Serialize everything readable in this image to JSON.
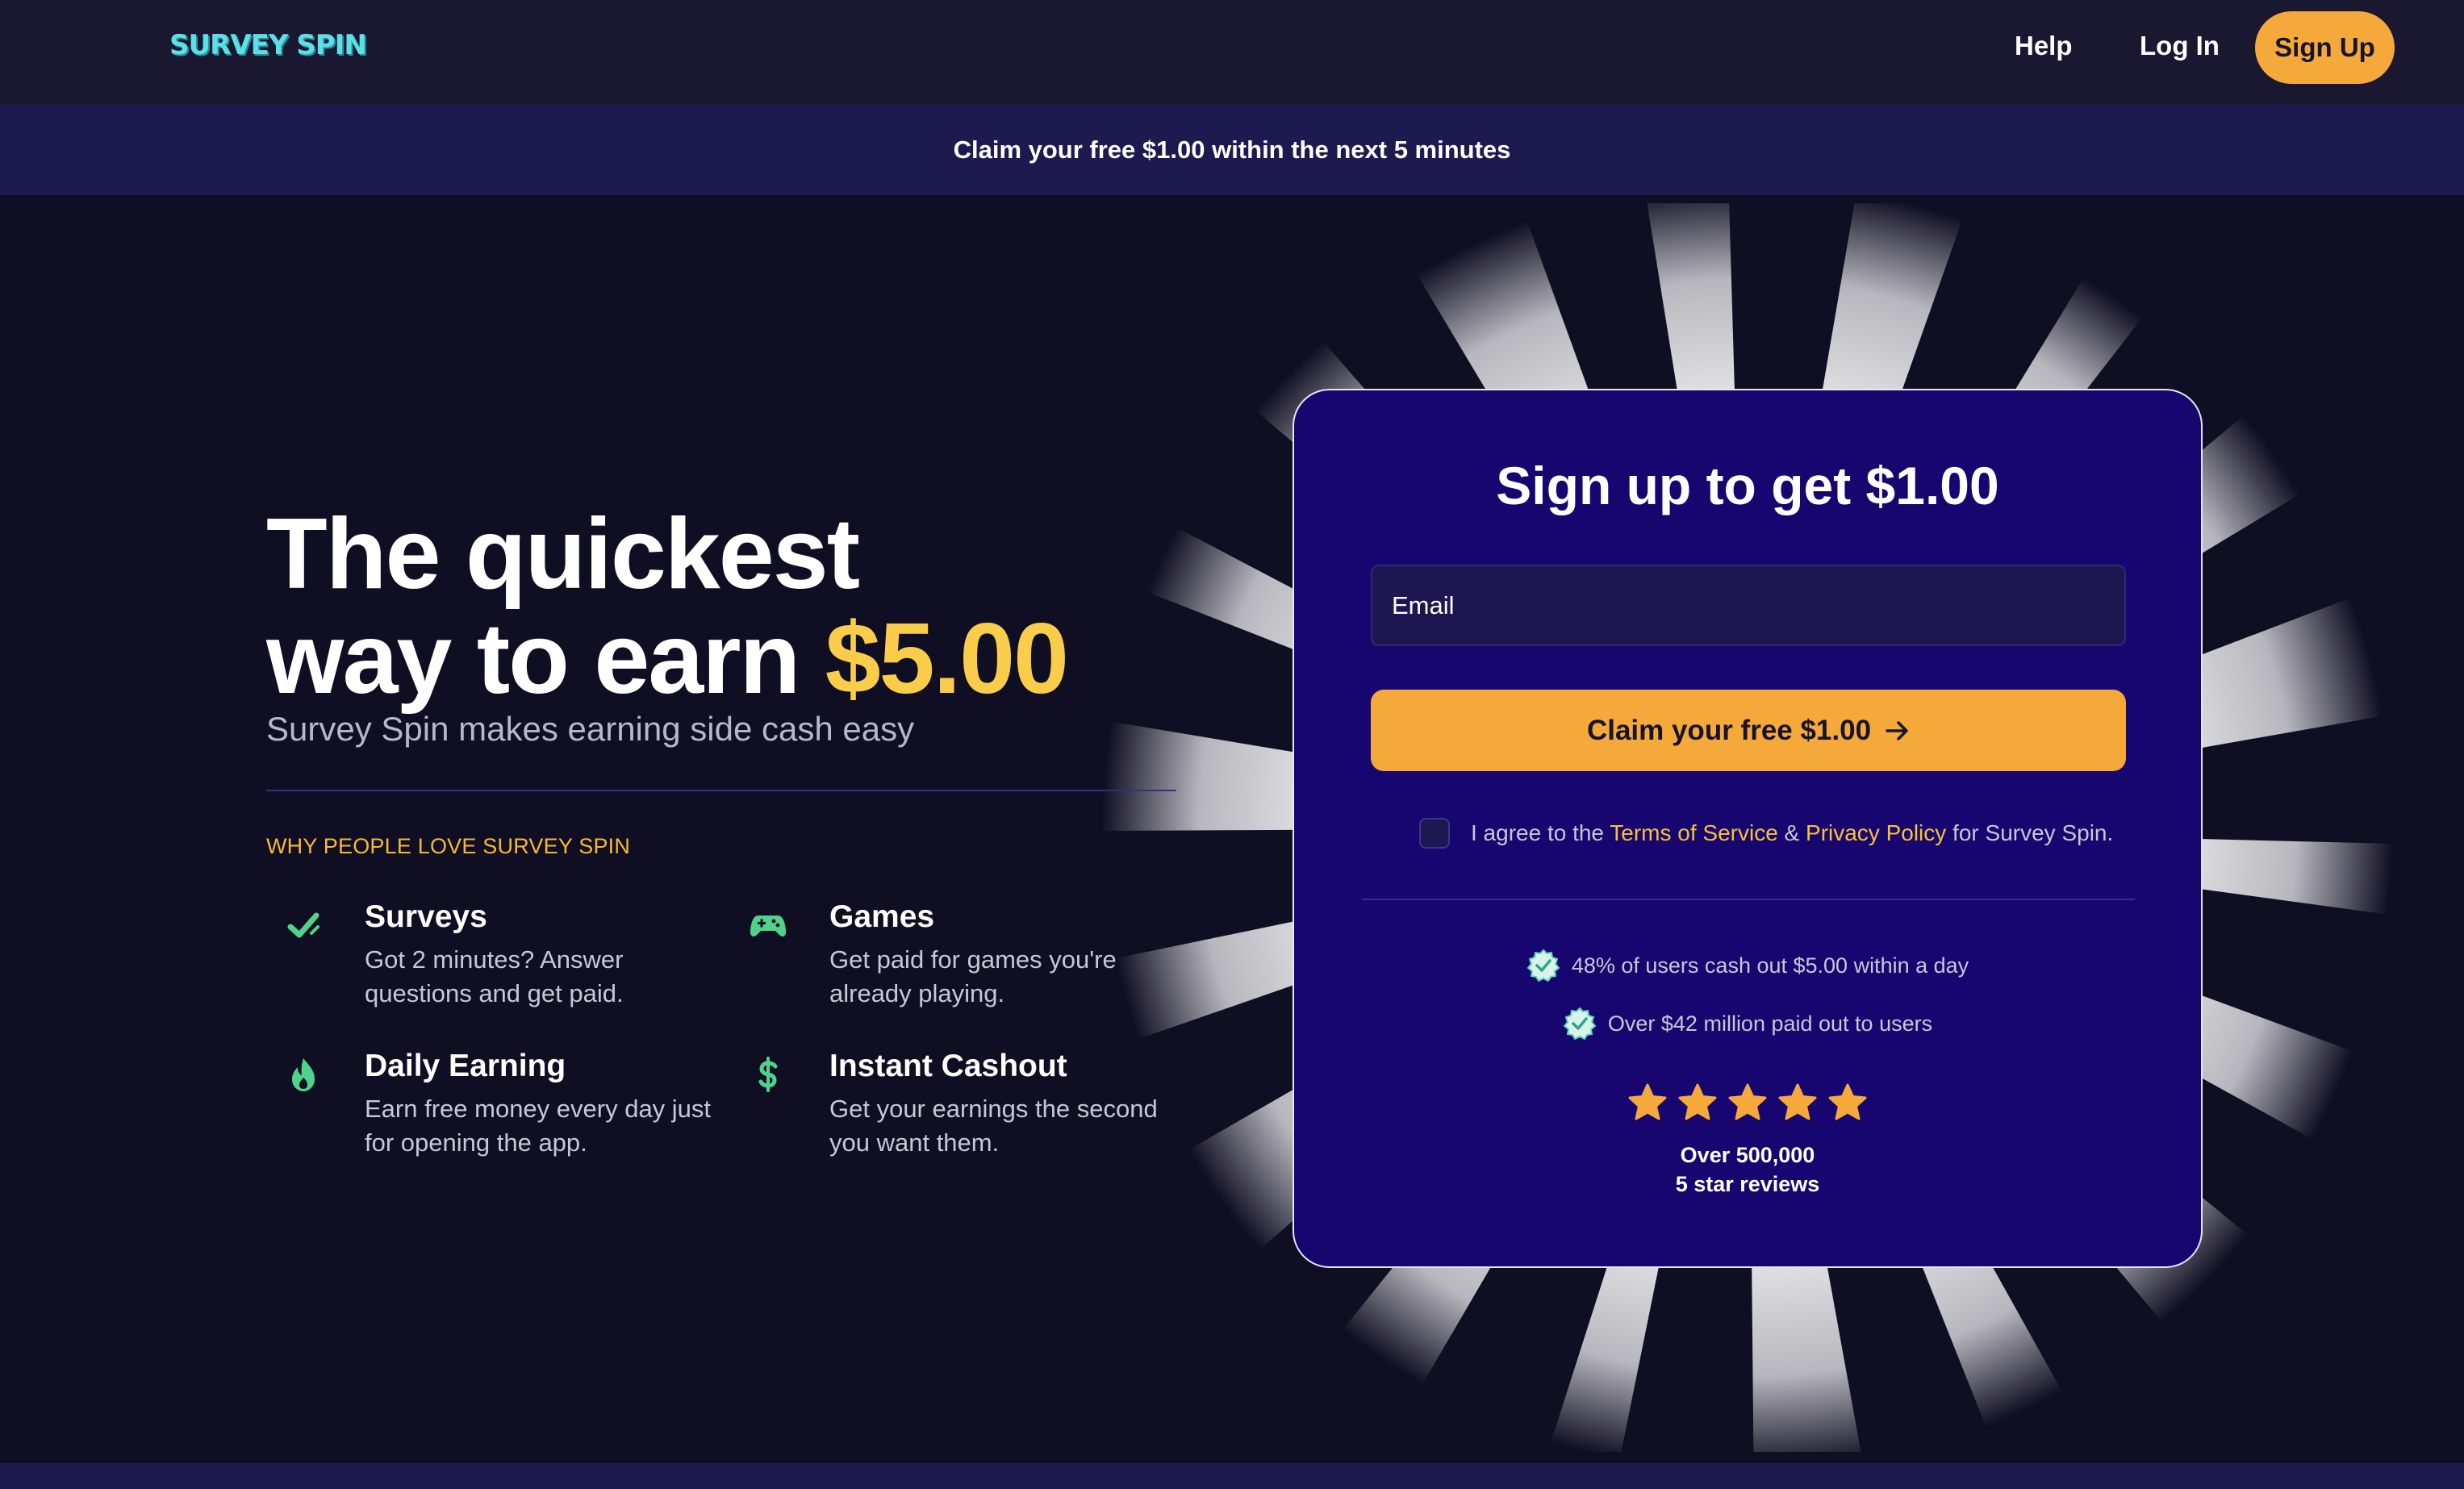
{
  "nav": {
    "logo": "SURVEY SPIN",
    "help": "Help",
    "login": "Log In",
    "signup": "Sign Up"
  },
  "banner": {
    "text": "Claim your free $1.00 within the next 5 minutes"
  },
  "hero": {
    "headline_line1": "The quickest",
    "headline_line2": "way to earn",
    "headline_amount": "$5.00",
    "subheadline": "Survey Spin makes earning side cash easy",
    "why_title": "WHY PEOPLE LOVE SURVEY SPIN",
    "features": [
      {
        "title": "Surveys",
        "desc": "Got 2 minutes? Answer questions and get paid.",
        "icon": "check-icon"
      },
      {
        "title": "Games",
        "desc": "Get paid for games you're already playing.",
        "icon": "gamepad-icon"
      },
      {
        "title": "Daily Earning",
        "desc": "Earn free money every day just for opening the app.",
        "icon": "flame-icon"
      },
      {
        "title": "Instant Cashout",
        "desc": "Get your earnings the second you want them.",
        "icon": "dollar-icon"
      }
    ]
  },
  "signup_card": {
    "title": "Sign up to get $1.00",
    "email_placeholder": "Email",
    "claim_button": "Claim your free $1.00",
    "agree_prefix": "I agree to the ",
    "terms": "Terms of Service",
    "amp": " & ",
    "privacy": "Privacy Policy",
    "agree_suffix": " for Survey Spin.",
    "stat1": "48% of users cash out $5.00 within a day",
    "stat2": "Over $42 million paid out to users",
    "rating": 5,
    "reviews_line1": "Over 500,000",
    "reviews_line2": "5 star reviews"
  },
  "colors": {
    "accent_orange": "#f5a93a",
    "accent_yellow": "#f9cd49",
    "logo_cyan": "#5ce0e6",
    "card_bg": "#180670",
    "feature_icon_green": "#4fd38a"
  }
}
